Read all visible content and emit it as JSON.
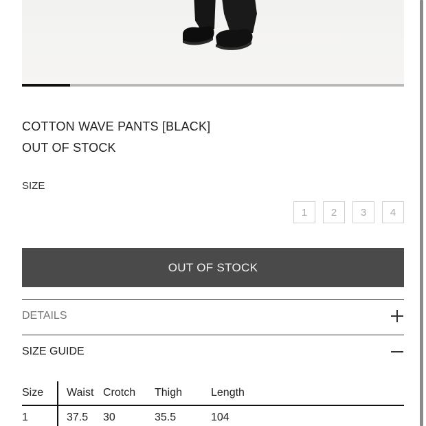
{
  "product": {
    "title": "COTTON WAVE PANTS [BLACK]",
    "stock_status": "OUT OF STOCK",
    "size_label": "SIZE",
    "sizes": [
      "1",
      "2",
      "3",
      "4"
    ],
    "gallery_progress": 0.125
  },
  "cta": {
    "label": "OUT OF STOCK"
  },
  "accordion": {
    "details_label": "DETAILS",
    "size_guide_label": "SIZE GUIDE"
  },
  "size_guide": {
    "headers": [
      "Size",
      "Waist",
      "Crotch",
      "Thigh",
      "Length"
    ],
    "rows": [
      [
        "1",
        "37.5",
        "30",
        "35.5",
        "104"
      ]
    ]
  },
  "colors": {
    "button_bg": "#4a4a4a",
    "accent": "#111111"
  }
}
